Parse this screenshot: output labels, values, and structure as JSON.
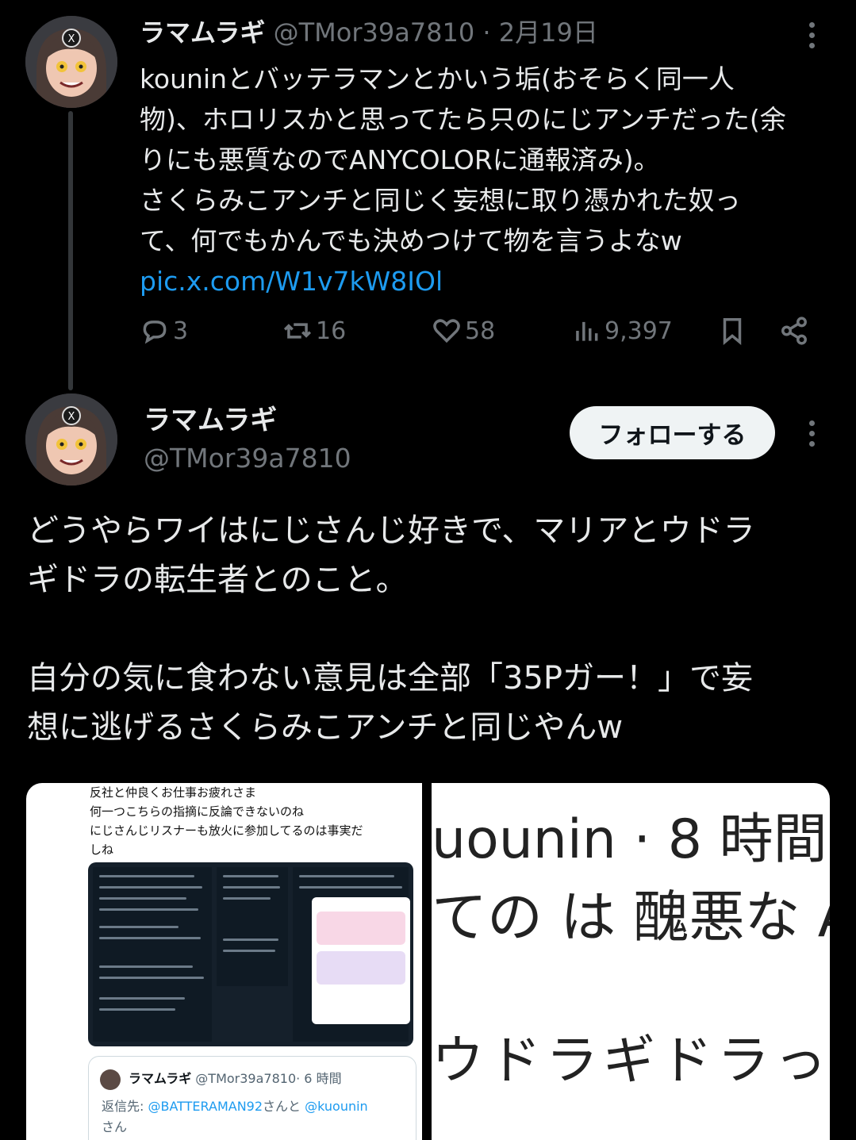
{
  "tweet1": {
    "name": "ラマムラギ",
    "handle": "@TMor39a7810",
    "separator": "·",
    "date": "2月19日",
    "lines": [
      "kouninとバッテラマンとかいう垢(おそらく同一人",
      "物)、ホロリスかと思ってたら只のにじアンチだった(余",
      "りにも悪質なのでANYCOLORに通報済み)。",
      "さくらみこアンチと同じく妄想に取り憑かれた奴っ",
      "て、何でもかんでも決めつけて物を言うよなw"
    ],
    "link": "pic.x.com/W1v7kW8IOl",
    "actions": {
      "replies": "3",
      "reposts": "16",
      "likes": "58",
      "views": "9,397"
    }
  },
  "tweet2": {
    "name": "ラマムラギ",
    "handle": "@TMor39a7810",
    "follow_label": "フォローする",
    "lines": [
      "どうやらワイはにじさんじ好きで、マリアとウドラ",
      "ギドラの転生者とのこと。"
    ],
    "lines2": [
      "自分の気に食わない意見は全部「35Pガー！」で妄",
      "想に逃げるさくらみこアンチと同じやんw"
    ]
  },
  "media_left": {
    "text_lines": [
      "反社と仲良くお仕事お疲れさま",
      "何一つこちらの指摘に反論できないのね",
      "にじさんじリスナーも放火に参加してるのは事実だ",
      "しね"
    ],
    "quote": {
      "name": "ラマムラギ",
      "handle": "@TMor39a7810",
      "time": "· 6 時間",
      "reply_prefix": "返信先: ",
      "mention1": "@BATTERAMAN92",
      "mid": "さんと ",
      "mention2": "@kuounin",
      "suffix": "さん"
    }
  },
  "media_right": {
    "line1": "uounin · 8 時間",
    "line2": "ての は 醜悪な AI 絵",
    "line3": "ウドラギドラっぽ"
  },
  "colors": {
    "background": "#000000",
    "text": "#e7e9ea",
    "muted": "#71767b",
    "link": "#1d9bf0",
    "follow_bg": "#eff3f4"
  },
  "icons": [
    "more-icon",
    "reply-icon",
    "repost-icon",
    "like-icon",
    "views-icon",
    "bookmark-icon",
    "share-icon"
  ]
}
